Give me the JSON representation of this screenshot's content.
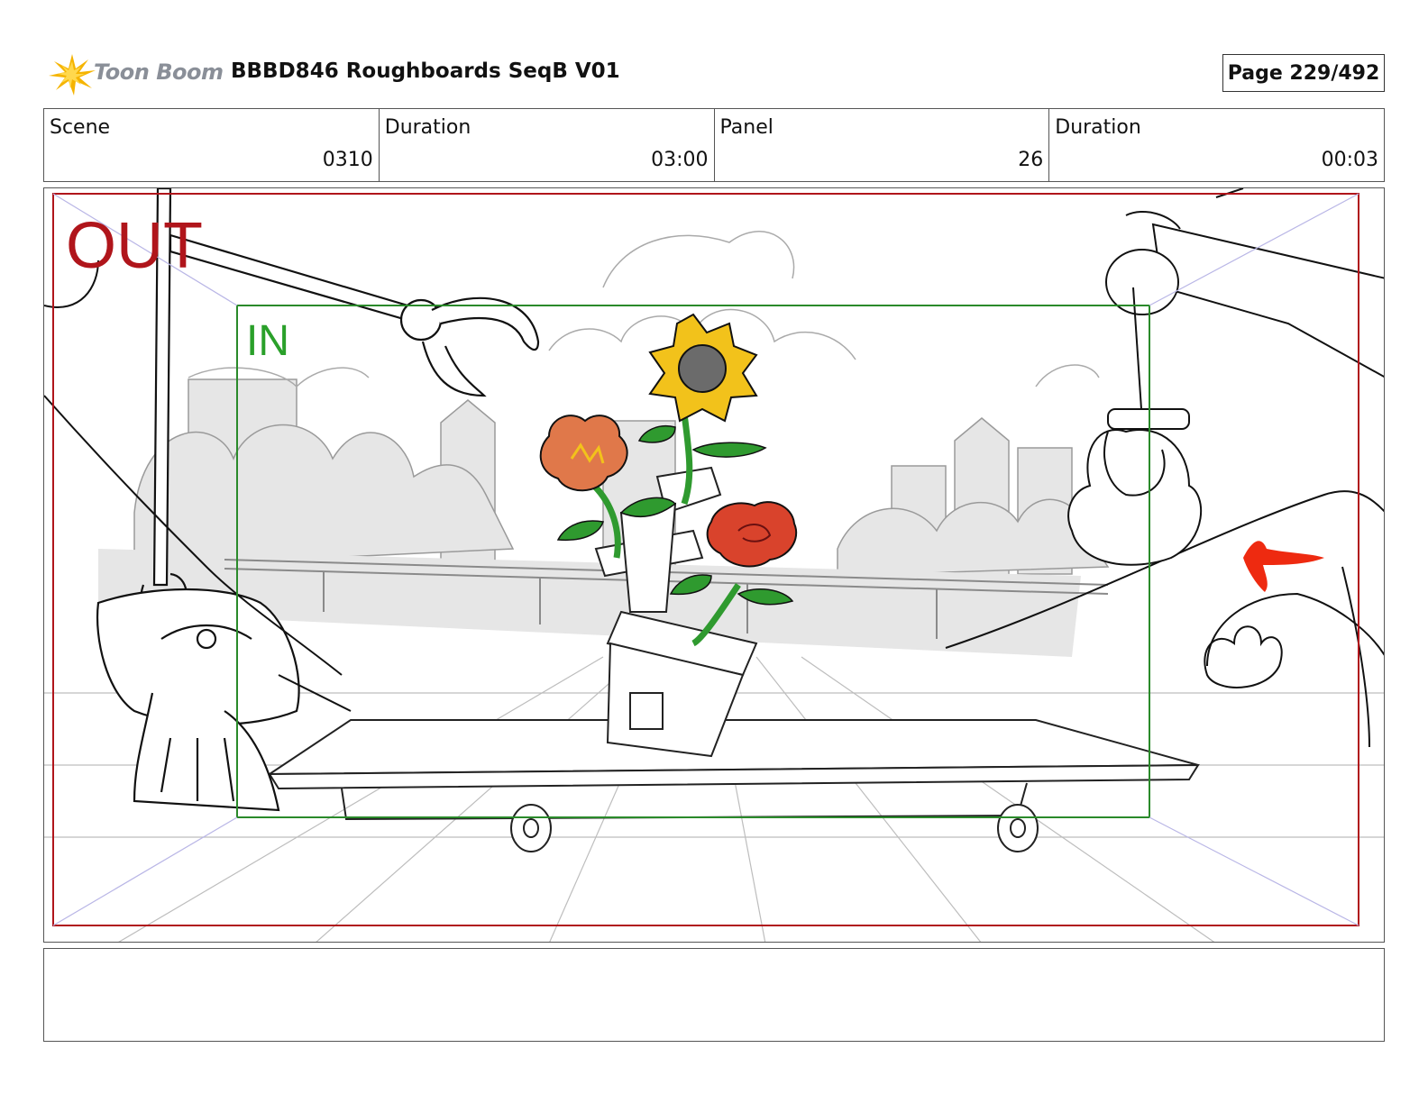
{
  "header": {
    "logo_text": "Toon Boom",
    "document_title": "BBBD846 Roughboards SeqB V01",
    "page_indicator": "Page 229/492"
  },
  "info": [
    {
      "label": "Scene",
      "value": "0310"
    },
    {
      "label": "Duration",
      "value": "03:00"
    },
    {
      "label": "Panel",
      "value": "26"
    },
    {
      "label": "Duration",
      "value": "00:03"
    }
  ],
  "panel": {
    "out_label": "OUT",
    "in_label": "IN",
    "colors": {
      "out_frame": "#b0151b",
      "in_frame": "#2a8a2a",
      "sunflower": "#f2c21b",
      "orange_flower": "#e0784a",
      "rose": "#d9432c",
      "leaf": "#2f9a2f",
      "red_arrow": "#ee2a10"
    }
  },
  "notes": {
    "text": ""
  }
}
